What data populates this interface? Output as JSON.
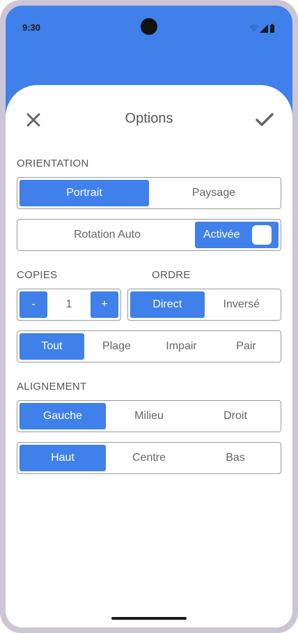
{
  "status_bar": {
    "time": "9:30"
  },
  "header": {
    "title": "Options",
    "close_icon": "close-icon",
    "confirm_icon": "check-icon"
  },
  "orientation": {
    "label": "ORIENTATION",
    "options": [
      "Portrait",
      "Paysage"
    ],
    "selected": "Portrait"
  },
  "rotation": {
    "label": "Rotation Auto",
    "toggle_label": "Activée",
    "enabled": true
  },
  "copies": {
    "label": "COPIES",
    "decrement_label": "-",
    "value": "1",
    "increment_label": "+"
  },
  "order": {
    "label": "ORDRE",
    "options": [
      "Direct",
      "Inversé"
    ],
    "selected": "Direct"
  },
  "pages": {
    "options": [
      "Tout",
      "Plage",
      "Impair",
      "Pair"
    ],
    "selected": "Tout"
  },
  "alignment": {
    "label": "ALIGNEMENT",
    "horizontal": {
      "options": [
        "Gauche",
        "Milieu",
        "Droit"
      ],
      "selected": "Gauche"
    },
    "vertical": {
      "options": [
        "Haut",
        "Centre",
        "Bas"
      ],
      "selected": "Haut"
    }
  },
  "colors": {
    "accent": "#3f80ea",
    "frame": "#cdc5d5",
    "text_muted": "#666666"
  }
}
